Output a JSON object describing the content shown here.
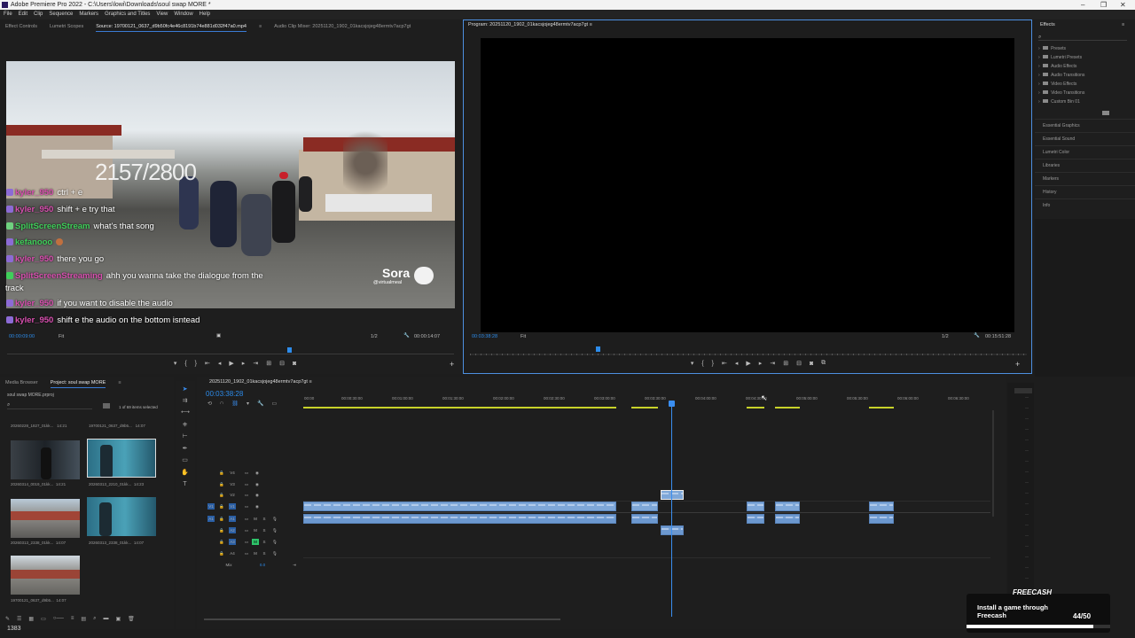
{
  "titlebar": {
    "title": "Adobe Premiere Pro 2022 - C:\\Users\\lowi\\Downloads\\soul swap MORE *",
    "minimize": "–",
    "maximize": "❐",
    "close": "✕"
  },
  "menu": [
    "File",
    "Edit",
    "Clip",
    "Sequence",
    "Markers",
    "Graphics and Titles",
    "View",
    "Window",
    "Help"
  ],
  "source_panel": {
    "tabs": [
      "Effect Controls",
      "Lumetri Scopes",
      "Source: 19700121_0637_d9b50fc4e46c8191b74e881d032f47a0.mp4",
      "Audio Clip Mixer: 20251120_1902_01kacsjojeg48ermtv7acp7gt"
    ],
    "active_tab_index": 2,
    "menu_icon": "≡",
    "timecode": "00:00:09:00",
    "fit": "Fit",
    "resolution": "1/2",
    "duration": "00:00:14:07",
    "playhead_fraction": 0.63
  },
  "overlay": {
    "counter": "2157/2800",
    "sora": "Sora",
    "sora_handle": "@virtualmeal",
    "chat": [
      {
        "user": "kyler_950",
        "user_color": "#d94fb0",
        "text": "ctrl + e"
      },
      {
        "user": "kyler_950",
        "user_color": "#d94fb0",
        "text": "shift + e try that"
      },
      {
        "user": "SplitScreenStream",
        "user_color": "#3fcf5a",
        "text": "what's that song"
      },
      {
        "user": "kefanooo",
        "user_color": "#3fcf5a",
        "text": ""
      },
      {
        "user": "kyler_950",
        "user_color": "#d94fb0",
        "text": "there you go"
      },
      {
        "user": "SplitScreenStreaming",
        "user_color": "#d94fb0",
        "text": "ahh you wanna take the dialogue from the"
      },
      {
        "user": "",
        "user_color": "#ffffff",
        "text": "track"
      },
      {
        "user": "kyler_950",
        "user_color": "#d94fb0",
        "text": "if you want to disable the audio"
      },
      {
        "user": "kyler_950",
        "user_color": "#d94fb0",
        "text": "shift e the audio on the bottom isntead"
      }
    ]
  },
  "program_panel": {
    "title": "Program: 20251120_1902_01kacsjojeg48ermtv7acp7gt",
    "menu_icon": "≡",
    "timecode": "00:03:38:28",
    "fit": "Fit",
    "resolution": "1/2",
    "duration": "00:15:51:28",
    "playhead_fraction": 0.23
  },
  "effects_panel": {
    "title": "Effects",
    "tree": [
      "Presets",
      "Lumetri Presets",
      "Audio Effects",
      "Audio Transitions",
      "Video Effects",
      "Video Transitions",
      "Custom Bin 01"
    ],
    "sections": [
      "Essential Graphics",
      "Essential Sound",
      "Lumetri Color",
      "Libraries",
      "Markers",
      "History",
      "Info"
    ]
  },
  "project_panel": {
    "tabs": [
      "Media Browser",
      "Project: soul swap MORE"
    ],
    "active_tab_index": 1,
    "project_file": "soul swap MORE.prproj",
    "selection": "1 of 69 items selected",
    "items": [
      {
        "name": "20260228_1827_01kk...",
        "duration": "14:21"
      },
      {
        "name": "19700121_0637_d9b5...",
        "duration": "14:07"
      },
      {
        "name": "20260314_0019_01kk...",
        "duration": "14:21"
      },
      {
        "name": "20260313_2210_01kk...",
        "duration": "14:23"
      },
      {
        "name": "20260313_2338_01kk...",
        "duration": "14:07"
      },
      {
        "name": "20260313_2338_01kk...",
        "duration": "14:07"
      },
      {
        "name": "19700121_0637_d9b5...",
        "duration": "14:07"
      }
    ],
    "top_labels": [
      {
        "name": "20260228_1827_01kk...",
        "duration": "14:21"
      },
      {
        "name": "19700121_0637_d9b5...",
        "duration": "14:07"
      }
    ]
  },
  "timeline": {
    "tab": "20251120_1902_01kacsjojeg48ermtv7acp7gt",
    "menu_icon": "≡",
    "timecode": "00:03:38:28",
    "ruler": [
      "00:00",
      "00:00:30:00",
      "00:01:00:00",
      "00:01:30:00",
      "00:02:00:00",
      "00:02:30:00",
      "00:03:00:00",
      "00:03:30:00",
      "00:04:00:00",
      "00:04:30:00",
      "00:05:00:00",
      "00:05:30:00",
      "00:06:00:00",
      "00:06:30:00"
    ],
    "video_tracks": [
      "V4",
      "V3",
      "V2",
      "V1"
    ],
    "audio_tracks": [
      "A1",
      "A2",
      "A3",
      "A4"
    ],
    "mix": "Mix",
    "mix_value": "0.0"
  },
  "ad": {
    "brand": "FREECASH",
    "text": "Install a game through Freecash",
    "progress": "44/50",
    "progress_fraction": 0.88
  },
  "status": {
    "count": "1383"
  },
  "colors": {
    "accent_blue": "#2d8ceb",
    "clip_blue": "#7ea7d8",
    "work_area_yellow": "#c8d22a"
  }
}
